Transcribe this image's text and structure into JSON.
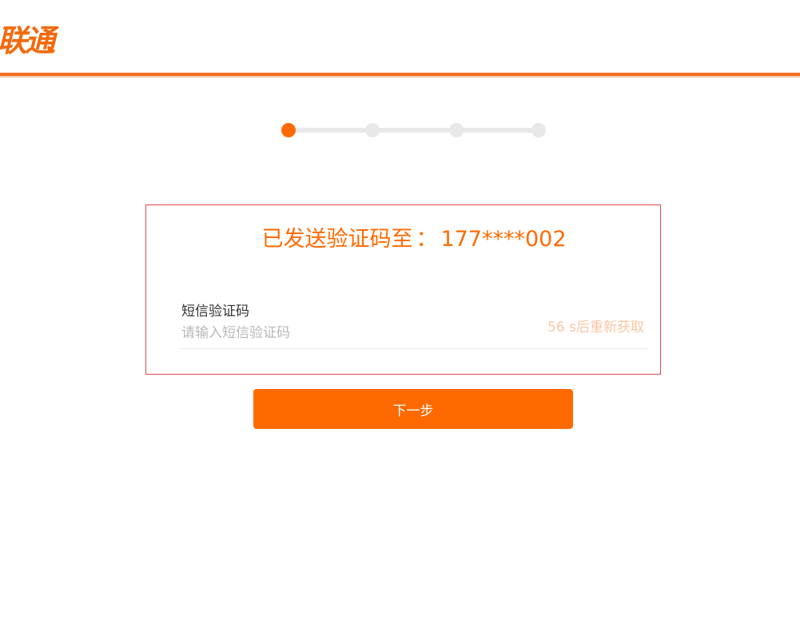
{
  "header": {
    "logo_text": "联通"
  },
  "stepper": {
    "total_steps": 4,
    "current_step": 1
  },
  "verify": {
    "sent_prefix": "已发送验证码至",
    "colon": "：",
    "phone": "177****002",
    "field_label": "短信验证码",
    "field_placeholder": "请输入短信验证码",
    "field_value": "",
    "resend_text": "56 s后重新获取"
  },
  "actions": {
    "next_label": "下一步"
  },
  "colors": {
    "brand": "#ff6a00",
    "header_line": "#f06d20",
    "card_border": "#e0474c",
    "resend_disabled": "#fbc6a4"
  }
}
